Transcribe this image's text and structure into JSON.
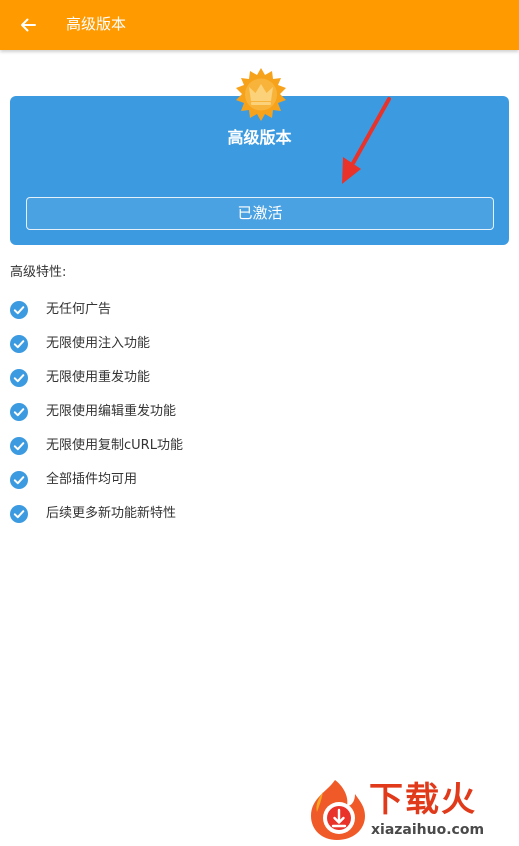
{
  "colors": {
    "appbar": "#ff9a00",
    "card": "#3c9be0",
    "check": "#3c9be0",
    "badge": "#f7a21b",
    "arrow": "#e8322a",
    "watermark": "#e03a1a"
  },
  "appbar": {
    "back_icon": "arrow-left-icon",
    "title": "高级版本"
  },
  "premium_card": {
    "badge_icon": "crown-badge-icon",
    "title": "高级版本",
    "button_label": "已激活"
  },
  "features": {
    "heading": "高级特性:",
    "check_icon": "check-circle-icon",
    "items": [
      {
        "label": "无任何广告"
      },
      {
        "label": "无限使用注入功能"
      },
      {
        "label": "无限使用重发功能"
      },
      {
        "label": "无限使用编辑重发功能"
      },
      {
        "label": "无限使用复制cURL功能"
      },
      {
        "label": "全部插件均可用"
      },
      {
        "label": "后续更多新功能新特性"
      }
    ]
  },
  "watermark": {
    "name": "下载火",
    "url": "xiazaihuo.com"
  }
}
